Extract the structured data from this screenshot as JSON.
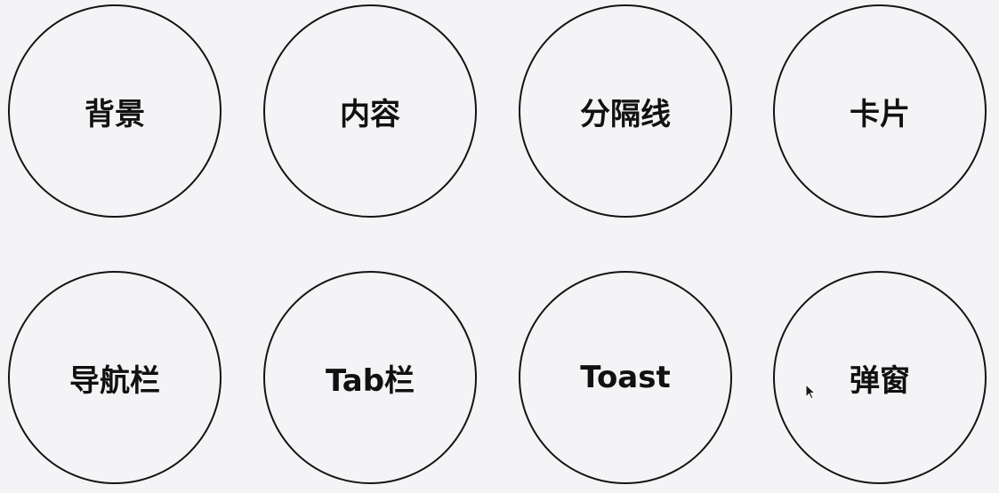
{
  "items": [
    {
      "label": "背景"
    },
    {
      "label": "内容"
    },
    {
      "label": "分隔线"
    },
    {
      "label": "卡片"
    },
    {
      "label": "导航栏"
    },
    {
      "label": "Tab栏"
    },
    {
      "label": "Toast"
    },
    {
      "label": "弹窗"
    }
  ],
  "colors": {
    "background": "#f4f4f6",
    "stroke": "#141414",
    "text": "#111111"
  },
  "cursor_icon": "mouse-pointer-icon"
}
